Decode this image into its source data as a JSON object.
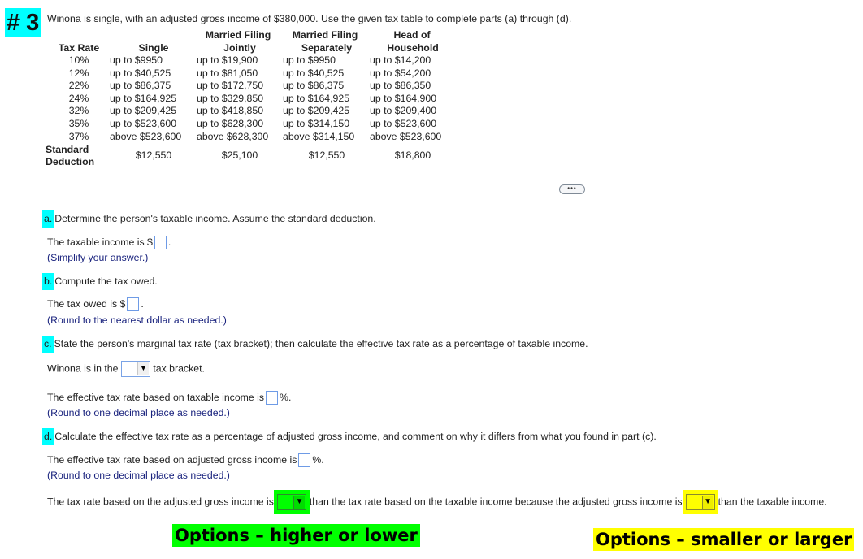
{
  "question": {
    "number": "# 3",
    "intro": "Winona is single, with an adjusted gross income of $380,000. Use the given tax table to complete parts (a) through (d)."
  },
  "tax_table": {
    "headers": {
      "rate": "Tax Rate",
      "single": "Single",
      "mfj_line1": "Married Filing",
      "mfj_line2": "Jointly",
      "mfs_line1": "Married Filing",
      "mfs_line2": "Separately",
      "hoh_line1": "Head of",
      "hoh_line2": "Household"
    },
    "rows": [
      {
        "rate": "10%",
        "single": "up to $9950",
        "mfj": "up to $19,900",
        "mfs": "up to $9950",
        "hoh": "up to $14,200"
      },
      {
        "rate": "12%",
        "single": "up to $40,525",
        "mfj": "up to $81,050",
        "mfs": "up to $40,525",
        "hoh": "up to $54,200"
      },
      {
        "rate": "22%",
        "single": "up to $86,375",
        "mfj": "up to $172,750",
        "mfs": "up to $86,375",
        "hoh": "up to $86,350"
      },
      {
        "rate": "24%",
        "single": "up to $164,925",
        "mfj": "up to $329,850",
        "mfs": "up to $164,925",
        "hoh": "up to $164,900"
      },
      {
        "rate": "32%",
        "single": "up to $209,425",
        "mfj": "up to $418,850",
        "mfs": "up to $209,425",
        "hoh": "up to $209,400"
      },
      {
        "rate": "35%",
        "single": "up to $523,600",
        "mfj": "up to $628,300",
        "mfs": "up to $314,150",
        "hoh": "up to $523,600"
      },
      {
        "rate": "37%",
        "single": "above $523,600",
        "mfj": "above $628,300",
        "mfs": "above $314,150",
        "hoh": "above $523,600"
      }
    ],
    "std_deduction": {
      "label_line1": "Standard",
      "label_line2": "Deduction",
      "single": "$12,550",
      "mfj": "$25,100",
      "mfs": "$12,550",
      "hoh": "$18,800"
    }
  },
  "more_button": "•••",
  "part_a": {
    "letter": "a.",
    "prompt": "Determine the person's taxable income. Assume the standard deduction.",
    "answer_prefix": "The taxable income is $",
    "answer_suffix": ".",
    "answer_value": "",
    "hint": "(Simplify your answer.)"
  },
  "part_b": {
    "letter": "b.",
    "prompt": "Compute the tax owed.",
    "answer_prefix": "The tax owed is $",
    "answer_suffix": ".",
    "answer_value": "",
    "hint": "(Round to the nearest dollar as needed.)"
  },
  "part_c": {
    "letter": "c.",
    "prompt": "State the person's marginal tax rate (tax bracket); then calculate the effective tax rate as a percentage of taxable income.",
    "bracket_prefix": "Winona is in the",
    "bracket_suffix": "tax bracket.",
    "bracket_selected": "",
    "effective_prefix": "The effective tax rate based on taxable income is",
    "effective_suffix": "%.",
    "effective_value": "",
    "hint": "(Round to one decimal place as needed.)"
  },
  "part_d": {
    "letter": "d.",
    "prompt": "Calculate the effective tax rate as a percentage of adjusted gross income, and comment on why it differs from what you found in part (c).",
    "effective_prefix": "The effective tax rate based on adjusted gross income is",
    "effective_suffix": "%.",
    "effective_value": "",
    "hint": "(Round to one decimal place as needed.)",
    "sentence_part1": "The tax rate based on the adjusted gross income is",
    "sentence_part2": "than the tax rate based on the taxable income because the adjusted gross income is",
    "sentence_part3": "than the taxable income.",
    "dropdown1_selected": "",
    "dropdown2_selected": ""
  },
  "annotations": {
    "green_note": "Options – higher or lower",
    "yellow_note": "Options – smaller or larger",
    "colors": {
      "cyan": "#00ffff",
      "green": "#00ff00",
      "yellow": "#ffff00"
    }
  }
}
